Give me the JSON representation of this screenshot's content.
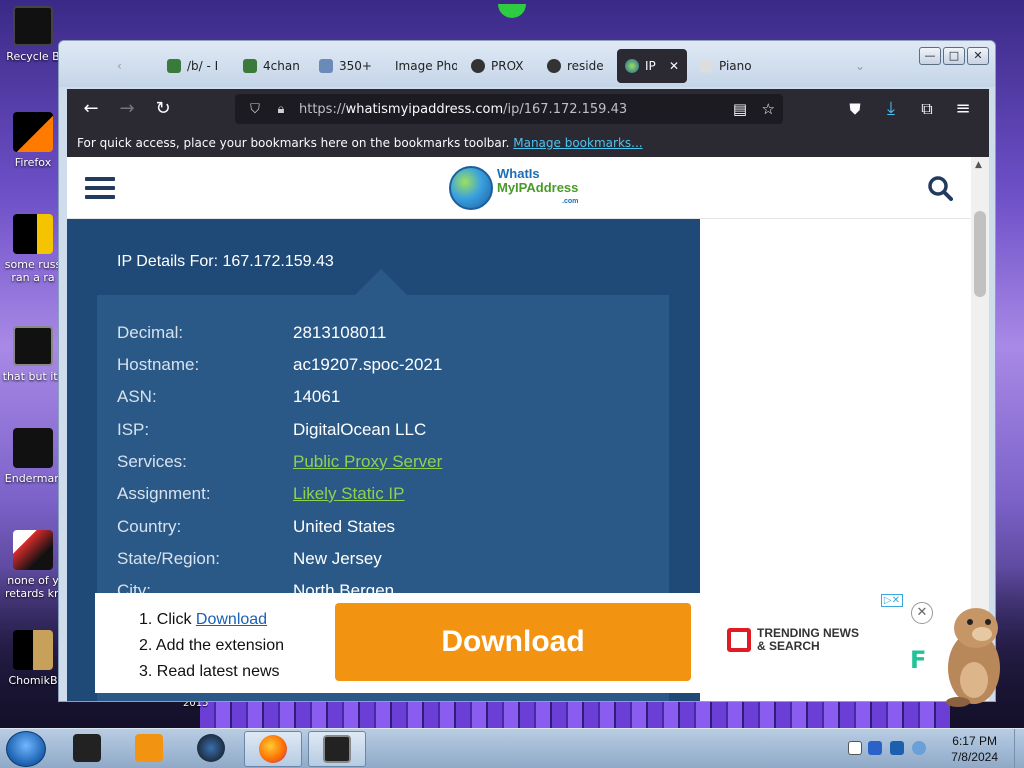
{
  "desktop": {
    "icons": [
      {
        "label": "Recycle B"
      },
      {
        "label": "Firefox"
      },
      {
        "label": "some russ"
      },
      {
        "label": "ran a ra"
      },
      {
        "label": "that but its"
      },
      {
        "label": "Enderman"
      },
      {
        "label": "none of y"
      },
      {
        "label": "retards kn"
      },
      {
        "label": "ChomikB"
      }
    ],
    "year_label": "2015"
  },
  "browser": {
    "tabs": [
      {
        "label": "/b/ - I"
      },
      {
        "label": "4chan"
      },
      {
        "label": "350+"
      },
      {
        "label": "Image Pho"
      },
      {
        "label": "PROX"
      },
      {
        "label": "reside"
      },
      {
        "label": "IP"
      },
      {
        "label": "Piano"
      }
    ],
    "window_buttons": {
      "minimize": "—",
      "maximize": "□",
      "close": "✕"
    },
    "url_prefix": "https://",
    "url_host": "whatismyipaddress.com",
    "url_path": "/ip/167.172.159.43",
    "bookmarks_text": "For quick access, place your bookmarks here on the bookmarks toolbar.",
    "bookmarks_link": "Manage bookmarks..."
  },
  "site": {
    "logo_line1": "WhatIs",
    "logo_line2": "MyIPAddress",
    "logo_line3": ".com",
    "panel_title": "IP Details For: 167.172.159.43",
    "details": [
      {
        "key": "Decimal:",
        "value": "2813108011"
      },
      {
        "key": "Hostname:",
        "value": "ac19207.spoc-2021"
      },
      {
        "key": "ASN:",
        "value": "14061"
      },
      {
        "key": "ISP:",
        "value": "DigitalOcean LLC"
      },
      {
        "key": "Services:",
        "value": "Public Proxy Server"
      },
      {
        "key": "Assignment:",
        "value": "Likely Static IP"
      },
      {
        "key": "Country:",
        "value": "United States"
      },
      {
        "key": "State/Region:",
        "value": "New Jersey"
      },
      {
        "key": "City:",
        "value": "North Bergen"
      }
    ]
  },
  "ad": {
    "step1_prefix": "1. Click ",
    "step1_link": "Download",
    "step2": "2. Add the extension",
    "step3": "3. Read latest news",
    "button": "Download",
    "brand_line1": "TRENDING NEWS",
    "brand_line2": "& SEARCH",
    "choice": "▷✕",
    "close": "✕",
    "f_mark": "F"
  },
  "taskbar": {
    "time": "6:17 PM",
    "date": "7/8/2024"
  },
  "colors": {
    "panel": "#1f4a77",
    "inner": "#2a5987",
    "link_green": "#8fd14f",
    "ad_orange": "#f29312",
    "browser_dark": "#2b2a33"
  }
}
